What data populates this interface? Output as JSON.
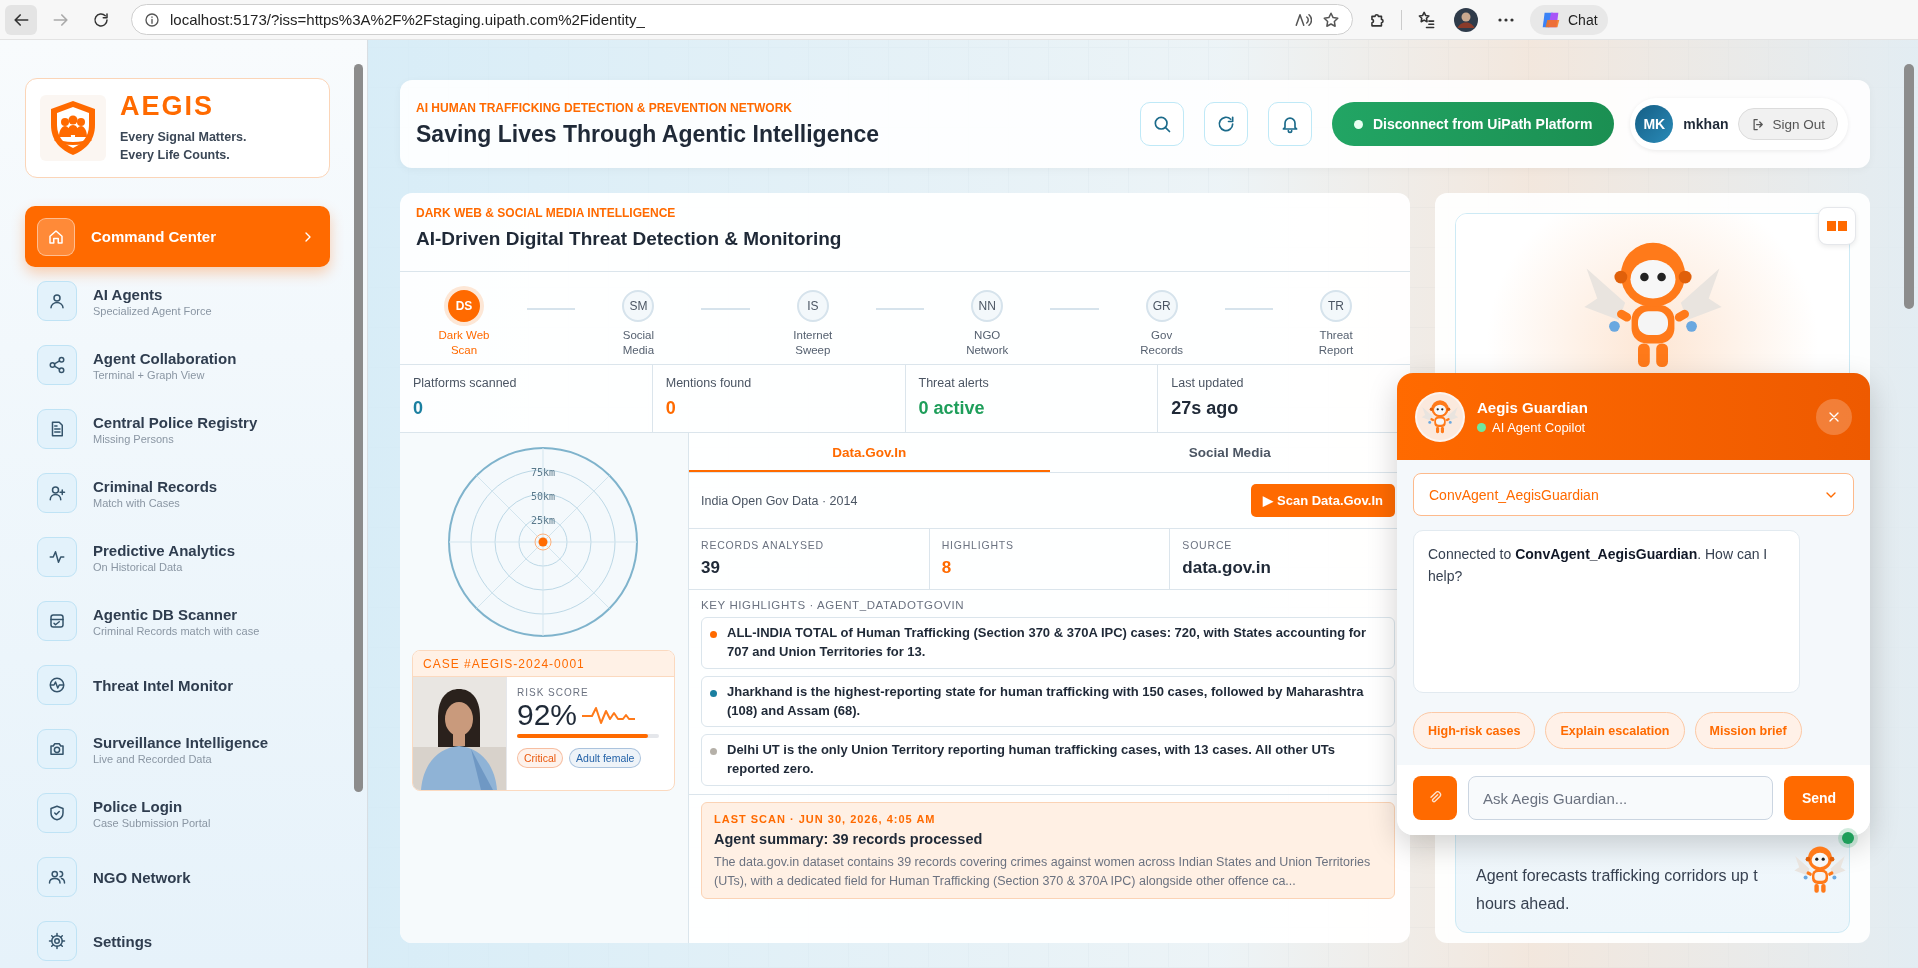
{
  "browser": {
    "url": "localhost:5173/?iss=https%3A%2F%2Fstaging.uipath.com%2Fidentity_",
    "chat_label": "Chat"
  },
  "sidebar": {
    "brand": {
      "name": "AEGIS",
      "tagline": [
        "Every Signal Matters.",
        "Every Life Counts."
      ]
    },
    "items": [
      {
        "label": "Command Center",
        "selected": true
      },
      {
        "label": "AI Agents",
        "sublabel": "Specialized Agent Force",
        "selected": false
      },
      {
        "label": "Agent Collaboration",
        "sublabel": "Terminal + Graph View",
        "selected": false
      },
      {
        "label": "Central Police Registry",
        "sublabel": "Missing Persons",
        "selected": false
      },
      {
        "label": "Criminal Records",
        "sublabel": "Match with Cases",
        "selected": false
      },
      {
        "label": "Predictive Analytics",
        "sublabel": "On Historical Data",
        "selected": false
      },
      {
        "label": "Agentic DB Scanner",
        "sublabel": "Criminal Records match with case",
        "selected": false
      },
      {
        "label": "Threat Intel Monitor",
        "selected": false
      },
      {
        "label": "Surveillance Intelligence",
        "sublabel": "Live and Recorded Data",
        "selected": false
      },
      {
        "label": "Police Login",
        "sublabel": "Case Submission Portal",
        "selected": false
      },
      {
        "label": "NGO Network",
        "selected": false
      },
      {
        "label": "Settings",
        "selected": false
      }
    ]
  },
  "header": {
    "kicker": "AI HUMAN TRAFFICKING DETECTION & PREVENTION NETWORK",
    "title": "Saving Lives Through Agentic Intelligence",
    "connect_button": "Disconnect from UiPath Platform",
    "user": {
      "initials": "MK",
      "name": "mkhan"
    },
    "sign_out": "Sign Out"
  },
  "threat_panel": {
    "kicker": "DARK WEB & SOCIAL MEDIA INTELLIGENCE",
    "title": "AI-Driven Digital Threat Detection & Monitoring",
    "steps": [
      {
        "code": "DS",
        "label": "Dark Web Scan",
        "selected": true
      },
      {
        "code": "SM",
        "label": "Social Media",
        "selected": false
      },
      {
        "code": "IS",
        "label": "Internet Sweep",
        "selected": false
      },
      {
        "code": "NN",
        "label": "NGO Network",
        "selected": false
      },
      {
        "code": "GR",
        "label": "Gov Records",
        "selected": false
      },
      {
        "code": "TR",
        "label": "Threat Report",
        "selected": false
      }
    ],
    "stats": [
      {
        "label": "Platforms scanned",
        "value": "0",
        "color": "#1a7fa0"
      },
      {
        "label": "Mentions found",
        "value": "0",
        "color": "#ff6a00"
      },
      {
        "label": "Threat alerts",
        "value": "0 active",
        "color": "#1e9e5a"
      },
      {
        "label": "Last updated",
        "value": "27s ago",
        "color": "#1f2937"
      }
    ],
    "radar": {
      "rings": [
        "75km",
        "50km",
        "25km"
      ]
    },
    "case": {
      "id": "CASE #AEGIS-2024-0001",
      "risk_label": "RISK SCORE",
      "risk": "92%",
      "level": 0.92,
      "tags": [
        {
          "label": "Critical",
          "color": "#ea580c"
        },
        {
          "label": "Adult female",
          "color": "#2563a8"
        }
      ]
    },
    "tabs": [
      {
        "label": "Data.Gov.In",
        "selected": true
      },
      {
        "label": "Social Media",
        "selected": false
      }
    ],
    "dataset": {
      "title": "India Open Gov Data · 2014",
      "scan_button": "▶ Scan Data.Gov.In"
    },
    "metrics": [
      {
        "label": "RECORDS ANALYSED",
        "value": "39",
        "color": "#1f2937"
      },
      {
        "label": "HIGHLIGHTS",
        "value": "8",
        "color": "#ff6a00"
      },
      {
        "label": "SOURCE",
        "value": "data.gov.in",
        "color": "#1f2937"
      }
    ],
    "highlights_label": "KEY HIGHLIGHTS · AGENT_DATADOTGOVIN",
    "highlights": [
      {
        "text": "ALL-INDIA TOTAL of Human Trafficking (Section 370 & 370A IPC) cases: 720, with States accounting for 707 and Union Territories for 13.",
        "color": "#ff6a00"
      },
      {
        "text": "Jharkhand is the highest-reporting state for human trafficking with 150 cases, followed by Maharashtra (108) and Assam (68).",
        "color": "#1a7fa0"
      },
      {
        "text": "Delhi UT is the only Union Territory reporting human trafficking cases, with 13 cases. All other UTs reported zero.",
        "color": "#b5b0a8"
      }
    ],
    "last_scan": {
      "label": "LAST SCAN · JUN 30, 2026, 4:05 AM",
      "title": "Agent summary: 39 records processed",
      "body": "The data.gov.in dataset contains 39 records covering crimes against women across Indian States and Union Territories (UTs), with a dedicated field for Human Trafficking (Section 370 & 370A IPC) alongside other offence ca..."
    }
  },
  "forecast": {
    "lines": [
      "Agent forecasts trafficking corridors up t",
      "hours ahead."
    ]
  },
  "chat": {
    "title": "Aegis Guardian",
    "subtitle": "AI Agent Copilot",
    "agent": "ConvAgent_AegisGuardian",
    "message": "Connected to **ConvAgent_AegisGuardian**. How can I help?",
    "chips": [
      "High-risk cases",
      "Explain escalation",
      "Mission brief"
    ],
    "placeholder": "Ask Aegis Guardian...",
    "send": "Send"
  }
}
